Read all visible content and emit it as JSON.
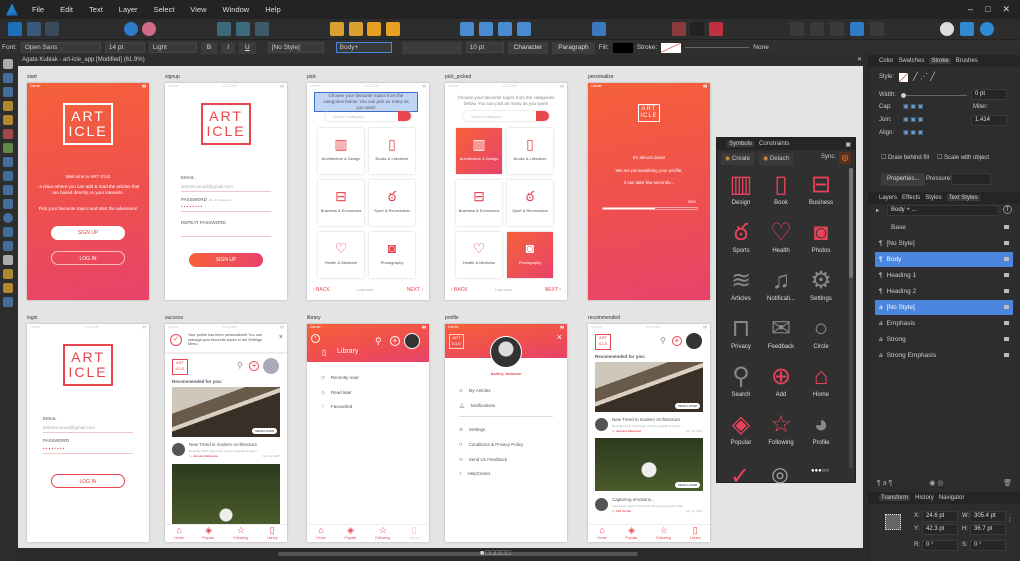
{
  "menu": [
    "File",
    "Edit",
    "Text",
    "Layer",
    "Select",
    "View",
    "Window",
    "Help"
  ],
  "context": {
    "font_label": "Font:",
    "font": "Open Sans",
    "size": "14 pt",
    "weight": "Light",
    "bold": "B",
    "italic": "I",
    "underline": "U",
    "char_style": "[No Style]",
    "para_style": "Body+",
    "spacing": "10 pt",
    "character": "Character",
    "paragraph": "Paragraph",
    "fill": "Fill:",
    "stroke": "Stroke:",
    "stroke_value": "None"
  },
  "document": {
    "title": "Agata Kubiak - art-icle_app [Modified] (61.9%)"
  },
  "artboards": {
    "start": {
      "name": "start",
      "carrier": "Carrier",
      "logo1": "ART",
      "logo2": "ICLE",
      "welcome": "Welcome to ART ICLE",
      "desc": "- a place where you can add & read the articles that are based directly on your interests.",
      "pick": "Pick your favourite topics and start the adventure!",
      "signup": "SIGN UP",
      "login": "LOG IN"
    },
    "signup": {
      "name": "signup",
      "carrier": "Carrier",
      "time": "10:10 AM",
      "logo1": "ART",
      "logo2": "ICLE",
      "email_label": "EMAIL",
      "email": "dolores.wood@gmail.com",
      "password_label": "PASSWORD",
      "password_hint": "min. 8 characters",
      "password": "• • • • • • • •",
      "repeat_label": "REPEAT PASSWORD",
      "signup": "SIGN UP"
    },
    "pick": {
      "name": "pick",
      "carrier": "Carrier",
      "time": "10:10 AM",
      "intro": "Choose your favourite topics from the categories below. You can pick as many as you want!",
      "search": "Search Category...",
      "back": "‹ BACK",
      "load": "Load more",
      "next": "NEXT ›"
    },
    "pick_picked": {
      "name": "pick_picked"
    },
    "categories": [
      "Architecture & Design",
      "Books & Literature",
      "Business & Economics",
      "Sport & Recreaction",
      "Health & Medicine",
      "Photography"
    ],
    "personalize": {
      "name": "personalize",
      "carrier": "Carrier",
      "l1": "It's almost done!",
      "l2": "We are personalising your profile,",
      "l3": "it can take few seconds...",
      "progress_label": "55%",
      "progress": 0.55
    },
    "login": {
      "name": "login",
      "carrier": "Carrier",
      "time": "10:10 AM",
      "email_label": "EMAIL",
      "email": "dolores.wood@gmail.com",
      "password_label": "PASSWORD",
      "password": "• • • • • • • •",
      "login": "LOG IN"
    },
    "success": {
      "name": "success",
      "carrier": "Carrier",
      "time": "10:10 AM",
      "notice": "Your profile has been personalized! You can manage your favourite topics in the Settings Menu.",
      "recommended": "Recommended for you:",
      "read_later": "READ LATER",
      "article_title": "New Trend in modern Architecture",
      "article_desc": "Recently there have been a lot of complaints about...",
      "by": "by",
      "author": "Jessica Simmons",
      "date": "Apr 13, 2017"
    },
    "library": {
      "name": "library",
      "carrier": "Carrier",
      "title": "Library",
      "items": [
        "Recently read",
        "Read later",
        "Favourited"
      ]
    },
    "profile": {
      "name": "profile",
      "carrier": "Carrier",
      "user": "Ashley Johnson",
      "items1": [
        "My Articles",
        "Notifications"
      ],
      "items2": [
        "Settings",
        "Conditions & Privacy Policy",
        "Send Us Feedback",
        "HelpCenter"
      ]
    },
    "recommended": {
      "name": "recommended",
      "carrier": "Carrier",
      "time": "10:10 AM",
      "recommended": "Recommended for you:",
      "read_later": "READ LATER",
      "a1_title": "New Trend in modern Architecture",
      "a1_desc": "Recently there have been a lot of complaints about...",
      "a1_author": "Jessica Simmons",
      "a1_date": "Apr 13, 2017",
      "a2_title": "Capturing emotions...",
      "a2_desc": "Last week I was on Richard's May photography exhib...",
      "a2_author": "Ted Archer",
      "a2_date": "Apr 12, 2017",
      "by": "by"
    },
    "nav": [
      "Home",
      "Popular",
      "Following",
      "Library"
    ]
  },
  "symbols": {
    "tabs": [
      "Symbols",
      "Constraints"
    ],
    "create": "Create",
    "detach": "Detach",
    "sync": "Sync:",
    "items": [
      {
        "label": "Design",
        "icon": "building-icon"
      },
      {
        "label": "Book",
        "icon": "book-icon"
      },
      {
        "label": "Business",
        "icon": "briefcase-icon"
      },
      {
        "label": "Sports",
        "icon": "bicycle-icon"
      },
      {
        "label": "Health",
        "icon": "heart-icon"
      },
      {
        "label": "Photos",
        "icon": "camera-icon"
      },
      {
        "label": "Articles",
        "icon": "layers-icon"
      },
      {
        "label": "Notificati...",
        "icon": "bell-icon"
      },
      {
        "label": "Settings",
        "icon": "gear-icon"
      },
      {
        "label": "Privacy",
        "icon": "lock-icon"
      },
      {
        "label": "Feedback",
        "icon": "envelope-icon"
      },
      {
        "label": "Circle",
        "icon": "circle-icon"
      },
      {
        "label": "Search",
        "icon": "search-icon"
      },
      {
        "label": "Add",
        "icon": "plus-circle-icon"
      },
      {
        "label": "Home",
        "icon": "home-icon"
      },
      {
        "label": "Popular",
        "icon": "diamond-icon"
      },
      {
        "label": "Following",
        "icon": "star-icon"
      },
      {
        "label": "Profile",
        "icon": "user-icon"
      }
    ]
  },
  "right": {
    "top_tabs": [
      "Color",
      "Swatches",
      "Stroke",
      "Brushes"
    ],
    "style_label": "Style:",
    "width_label": "Width:",
    "width": "0 pt",
    "cap": "Cap:",
    "join": "Join:",
    "align": "Align:",
    "miter": "Miter:",
    "miter_value": "1.414",
    "draw_behind": "Draw behind fill",
    "scale_with": "Scale with object",
    "properties": "Properties...",
    "pressure": "Pressure:",
    "mid_tabs": [
      "Layers",
      "Effects",
      "Styles",
      "Text Styles"
    ],
    "current_style": "Body + ...",
    "styles": [
      {
        "label": "Base",
        "sym": "",
        "sel": false
      },
      {
        "label": "[No Style]",
        "sym": "¶",
        "sel": false
      },
      {
        "label": "Body",
        "sym": "¶",
        "sel": true
      },
      {
        "label": "Heading 1",
        "sym": "¶",
        "sel": false
      },
      {
        "label": "Heading 2",
        "sym": "¶",
        "sel": false
      },
      {
        "label": "[No Style]",
        "sym": "a",
        "sel": true
      },
      {
        "label": "Emphasis",
        "sym": "a",
        "sel": false
      },
      {
        "label": "Strong",
        "sym": "a",
        "sel": false
      },
      {
        "label": "Strong Emphasis",
        "sym": "a",
        "sel": false
      }
    ],
    "bottom_tabs": [
      "Transform",
      "History",
      "Navigator"
    ],
    "transform": {
      "x_label": "X:",
      "x": "24.6 pt",
      "y_label": "Y:",
      "y": "42.3 pt",
      "w_label": "W:",
      "w": "305.4 pt",
      "h_label": "H:",
      "h": "36.7 pt",
      "r_label": "R:",
      "r": "0 °",
      "s_label": "S:",
      "s": "0 °"
    }
  },
  "colors": {
    "accent": "#e8454d",
    "gradient_start": "#f5613a",
    "gradient_end": "#e8436b",
    "selection": "#4a86e0"
  }
}
